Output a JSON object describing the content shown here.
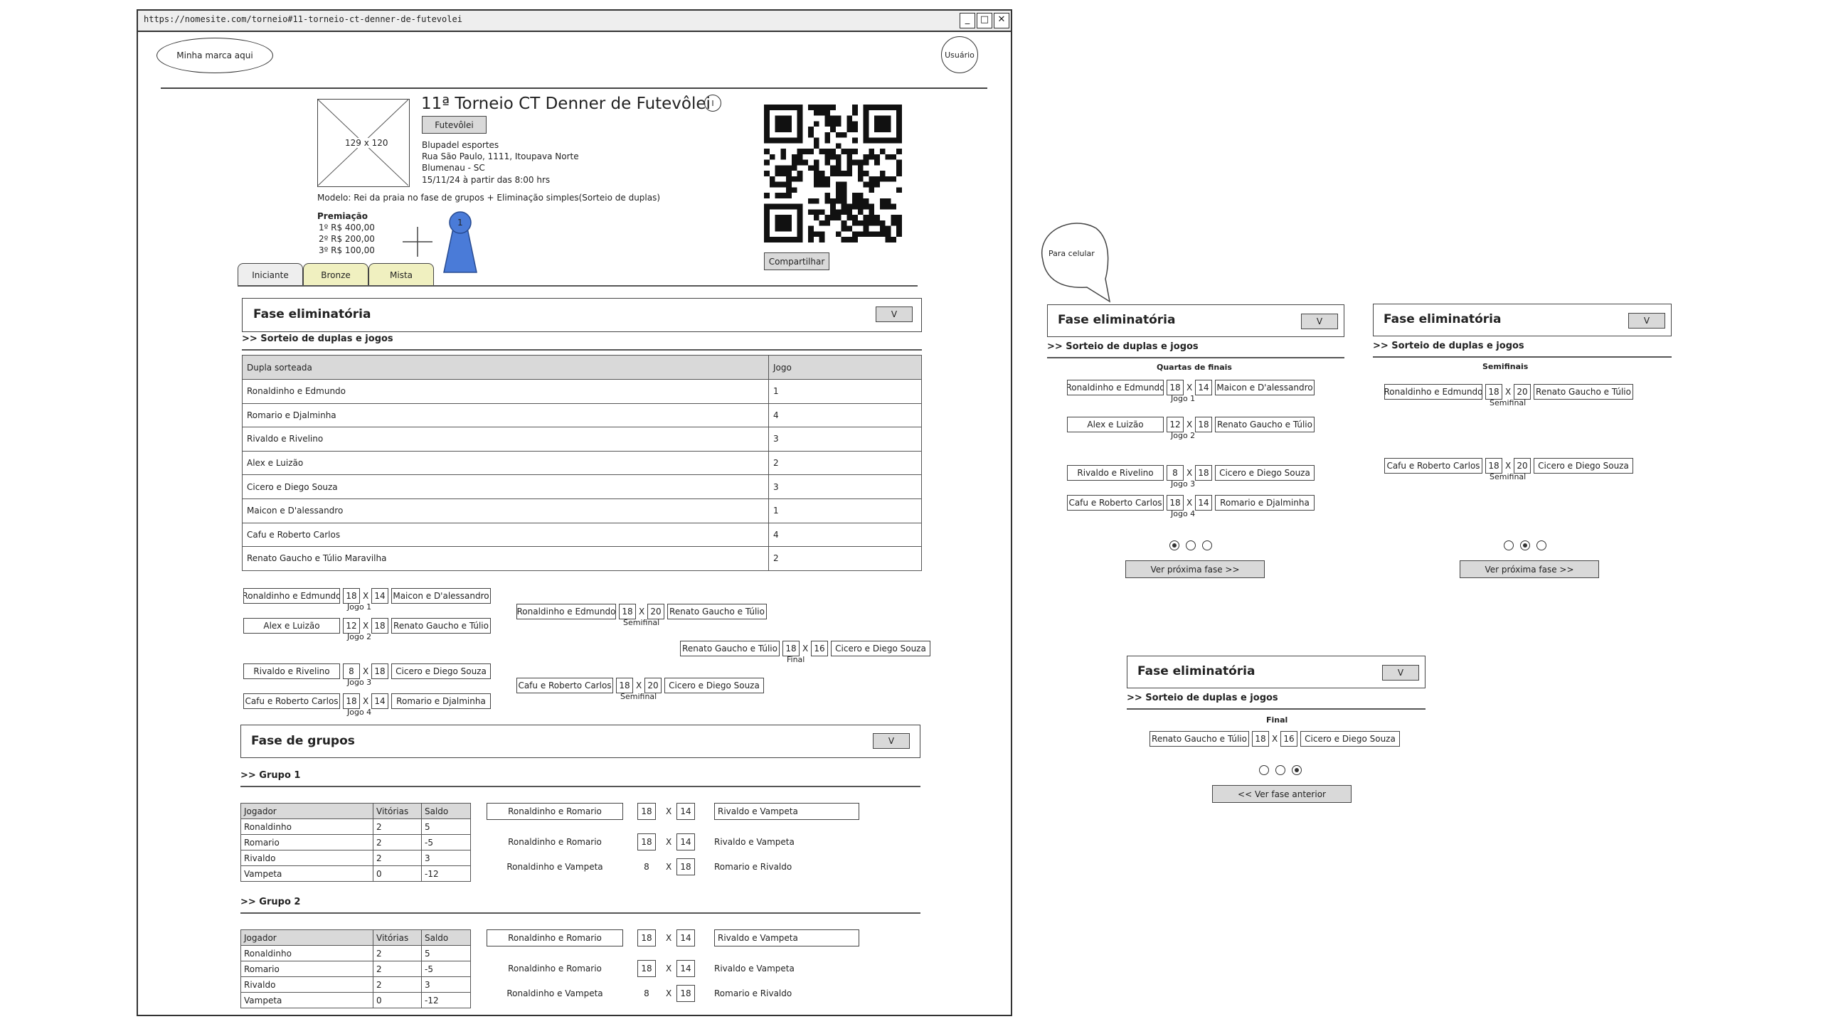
{
  "browser": {
    "url": "https://nomesite.com/torneio#11-torneio-ct-denner-de-futevolei",
    "btn_min": "_",
    "btn_max": "□",
    "btn_close": "✕"
  },
  "header": {
    "brand": "Minha marca aqui",
    "user": "Usuário"
  },
  "tournament": {
    "image_placeholder": "129 x 120",
    "title": "11ª Torneio CT Denner de Futevôlei",
    "info_icon": "I",
    "sport_tag": "Futevôlei",
    "venue": "Blupadel esportes",
    "address": "Rua São Paulo, 1111, Itoupava Norte",
    "city": "Blumenau - SC",
    "datetime": "15/11/24 à partir das 8:00 hrs",
    "model": "Modelo: Rei da praia no fase de grupos + Eliminação simples(Sorteio de duplas)",
    "prize_title": "Premiação",
    "prizes": [
      "1º  R$ 400,00",
      "2º  R$ 200,00",
      "3º  R$ 100,00"
    ],
    "pin_number": "1",
    "share": "Compartilhar"
  },
  "tabs": [
    "Iniciante",
    "Bronze",
    "Mista"
  ],
  "colors": {
    "tab_active": "#eeeeee",
    "tab_inactive": "#f0f0c0",
    "button": "#d9d9d9",
    "pin": "#4a7bd8"
  },
  "elim": {
    "title": "Fase eliminatória",
    "toggle": "V",
    "subtitle": ">> Sorteio de duplas e jogos",
    "col_pair": "Dupla sorteada",
    "col_game": "Jogo",
    "rows": [
      [
        "Ronaldinho e Edmundo",
        "1"
      ],
      [
        "Romario e Djalminha",
        "4"
      ],
      [
        "Rivaldo e Rivelino",
        "3"
      ],
      [
        "Alex e Luizão",
        "2"
      ],
      [
        "Cicero e Diego Souza",
        "3"
      ],
      [
        "Maicon e D'alessandro",
        "1"
      ],
      [
        "Cafu e Roberto Carlos",
        "4"
      ],
      [
        "Renato Gaucho e Túlio Maravilha",
        "2"
      ]
    ]
  },
  "bracket": {
    "x": "X",
    "qf": [
      {
        "a": "Ronaldinho e Edmundo",
        "sa": "18",
        "sb": "14",
        "b": "Maicon e D'alessandro",
        "label": "Jogo 1"
      },
      {
        "a": "Alex e Luizão",
        "sa": "12",
        "sb": "18",
        "b": "Renato Gaucho e Túlio",
        "label": "Jogo 2"
      },
      {
        "a": "Rivaldo e Rivelino",
        "sa": "8",
        "sb": "18",
        "b": "Cicero e Diego Souza",
        "label": "Jogo 3"
      },
      {
        "a": "Cafu e Roberto Carlos",
        "sa": "18",
        "sb": "14",
        "b": "Romario e Djalminha",
        "label": "Jogo 4"
      }
    ],
    "sf": [
      {
        "a": "Ronaldinho e Edmundo",
        "sa": "18",
        "sb": "20",
        "b": "Renato Gaucho e Túlio",
        "label": "Semifinal"
      },
      {
        "a": "Cafu e Roberto Carlos",
        "sa": "18",
        "sb": "20",
        "b": "Cicero e Diego Souza",
        "label": "Semifinal"
      }
    ],
    "final": {
      "a": "Renato Gaucho e Túlio",
      "sa": "18",
      "sb": "16",
      "b": "Cicero e Diego Souza",
      "label": "Final"
    }
  },
  "groups": {
    "title": "Fase de grupos",
    "toggle": "V",
    "cols": [
      "Jogador",
      "Vitórias",
      "Saldo"
    ],
    "list": [
      {
        "name": ">> Grupo 1",
        "rows": [
          [
            "Ronaldinho",
            "2",
            "5"
          ],
          [
            "Romario",
            "2",
            "-5"
          ],
          [
            "Rivaldo",
            "2",
            "3"
          ],
          [
            "Vampeta",
            "0",
            "-12"
          ]
        ],
        "games": [
          {
            "a": "Ronaldinho e Romario",
            "sa": "18",
            "sb": "14",
            "b": "Rivaldo e Vampeta"
          },
          {
            "a": "Ronaldinho e Romario",
            "sa": "18",
            "sb": "14",
            "b": "Rivaldo e Vampeta"
          },
          {
            "a": "Ronaldinho e Vampeta",
            "sa": "8",
            "sb": "18",
            "b": "Romario e Rivaldo"
          }
        ]
      },
      {
        "name": ">> Grupo 2",
        "rows": [
          [
            "Ronaldinho",
            "2",
            "5"
          ],
          [
            "Romario",
            "2",
            "-5"
          ],
          [
            "Rivaldo",
            "2",
            "3"
          ],
          [
            "Vampeta",
            "0",
            "-12"
          ]
        ],
        "games": [
          {
            "a": "Ronaldinho e Romario",
            "sa": "18",
            "sb": "14",
            "b": "Rivaldo e Vampeta"
          },
          {
            "a": "Ronaldinho e Romario",
            "sa": "18",
            "sb": "14",
            "b": "Rivaldo e Vampeta"
          },
          {
            "a": "Ronaldinho e Vampeta",
            "sa": "8",
            "sb": "18",
            "b": "Romario e Rivaldo"
          }
        ]
      }
    ]
  },
  "mobile": {
    "callout": "Para celular",
    "title": "Fase eliminatória",
    "toggle": "V",
    "subtitle": ">> Sorteio de duplas e jogos",
    "qf_title": "Quartas de finais",
    "sf_title": "Semifinais",
    "final_title": "Final",
    "next": "Ver próxima fase >>",
    "prev": "<< Ver fase anterior"
  }
}
